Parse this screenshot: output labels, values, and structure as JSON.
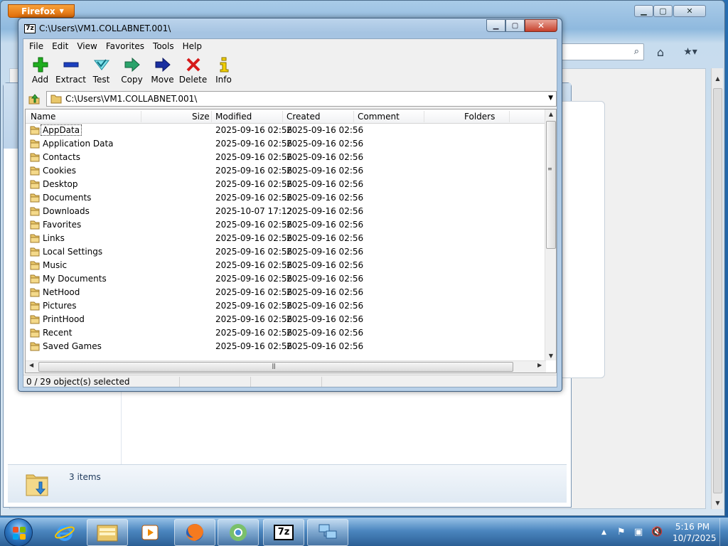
{
  "firefox": {
    "button_label": "Firefox",
    "caption_min": "▁",
    "caption_max": "▢",
    "caption_close": "✕"
  },
  "explorer": {
    "items_count": "3 items"
  },
  "sevenzip": {
    "logo": "7z",
    "title": "C:\\Users\\VM1.COLLABNET.001\\",
    "menu": [
      "File",
      "Edit",
      "View",
      "Favorites",
      "Tools",
      "Help"
    ],
    "toolbar": [
      {
        "label": "Add",
        "icon": "plus-icon",
        "color": "#1fae1f"
      },
      {
        "label": "Extract",
        "icon": "minus-icon",
        "color": "#1b3fbf"
      },
      {
        "label": "Test",
        "icon": "check-icon",
        "color": "#27a6b8"
      },
      {
        "label": "Copy",
        "icon": "double-arrow-icon",
        "color": "#2ba36b"
      },
      {
        "label": "Move",
        "icon": "arrow-right-icon",
        "color": "#1a2fa0"
      },
      {
        "label": "Delete",
        "icon": "x-icon",
        "color": "#d61a1a"
      },
      {
        "label": "Info",
        "icon": "info-icon",
        "color": "#d8b400"
      }
    ],
    "address": "C:\\Users\\VM1.COLLABNET.001\\",
    "columns": [
      "Name",
      "Size",
      "Modified",
      "Created",
      "Comment",
      "Folders"
    ],
    "rows": [
      {
        "name": "AppData",
        "modified": "2025-09-16 02:56",
        "created": "2025-09-16 02:56"
      },
      {
        "name": "Application Data",
        "modified": "2025-09-16 02:56",
        "created": "2025-09-16 02:56"
      },
      {
        "name": "Contacts",
        "modified": "2025-09-16 02:56",
        "created": "2025-09-16 02:56"
      },
      {
        "name": "Cookies",
        "modified": "2025-09-16 02:56",
        "created": "2025-09-16 02:56"
      },
      {
        "name": "Desktop",
        "modified": "2025-09-16 02:56",
        "created": "2025-09-16 02:56"
      },
      {
        "name": "Documents",
        "modified": "2025-09-16 02:56",
        "created": "2025-09-16 02:56"
      },
      {
        "name": "Downloads",
        "modified": "2025-10-07 17:12",
        "created": "2025-09-16 02:56"
      },
      {
        "name": "Favorites",
        "modified": "2025-09-16 02:56",
        "created": "2025-09-16 02:56"
      },
      {
        "name": "Links",
        "modified": "2025-09-16 02:56",
        "created": "2025-09-16 02:56"
      },
      {
        "name": "Local Settings",
        "modified": "2025-09-16 02:56",
        "created": "2025-09-16 02:56"
      },
      {
        "name": "Music",
        "modified": "2025-09-16 02:56",
        "created": "2025-09-16 02:56"
      },
      {
        "name": "My Documents",
        "modified": "2025-09-16 02:56",
        "created": "2025-09-16 02:56"
      },
      {
        "name": "NetHood",
        "modified": "2025-09-16 02:56",
        "created": "2025-09-16 02:56"
      },
      {
        "name": "Pictures",
        "modified": "2025-09-16 02:56",
        "created": "2025-09-16 02:56"
      },
      {
        "name": "PrintHood",
        "modified": "2025-09-16 02:56",
        "created": "2025-09-16 02:56"
      },
      {
        "name": "Recent",
        "modified": "2025-09-16 02:56",
        "created": "2025-09-16 02:56"
      },
      {
        "name": "Saved Games",
        "modified": "2025-09-16 02:56",
        "created": "2025-09-16 02:56"
      }
    ],
    "status": "0 / 29 object(s) selected"
  },
  "taskbar": {
    "time": "5:16 PM",
    "date": "10/7/2025",
    "apps": [
      "internet-explorer-icon",
      "explorer-folder-icon",
      "media-player-icon",
      "firefox-icon",
      "chrome-icon",
      "7zip-icon",
      "network-icon"
    ]
  }
}
